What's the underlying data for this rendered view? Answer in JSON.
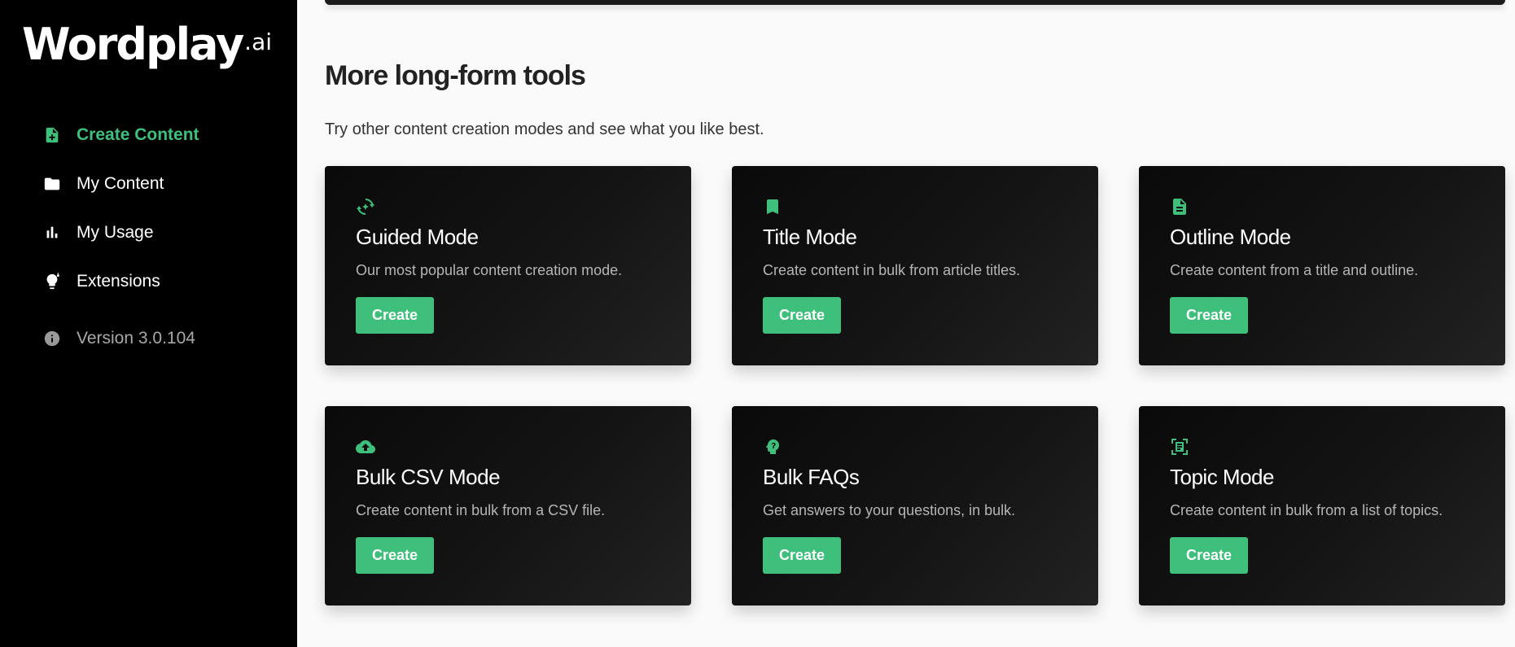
{
  "brand": {
    "name": "Wordplay",
    "suffix": ".ai"
  },
  "sidebar": {
    "items": [
      {
        "label": "Create Content",
        "icon": "file-plus-icon",
        "active": true
      },
      {
        "label": "My Content",
        "icon": "folder-icon",
        "active": false
      },
      {
        "label": "My Usage",
        "icon": "bar-chart-icon",
        "active": false
      },
      {
        "label": "Extensions",
        "icon": "lightbulb-icon",
        "active": false
      }
    ],
    "version": {
      "label": "Version 3.0.104",
      "icon": "info-icon"
    }
  },
  "main": {
    "title": "More long-form tools",
    "subtitle": "Try other content creation modes and see what you like best.",
    "cards": [
      {
        "title": "Guided Mode",
        "description": "Our most popular content creation mode.",
        "button": "Create",
        "icon": "guided-refresh-icon"
      },
      {
        "title": "Title Mode",
        "description": "Create content in bulk from article titles.",
        "button": "Create",
        "icon": "bookmark-icon"
      },
      {
        "title": "Outline Mode",
        "description": "Create content from a title and outline.",
        "button": "Create",
        "icon": "document-icon"
      },
      {
        "title": "Bulk CSV Mode",
        "description": "Create content in bulk from a CSV file.",
        "button": "Create",
        "icon": "cloud-upload-icon"
      },
      {
        "title": "Bulk FAQs",
        "description": "Get answers to your questions, in bulk.",
        "button": "Create",
        "icon": "head-question-icon"
      },
      {
        "title": "Topic Mode",
        "description": "Create content in bulk from a list of topics.",
        "button": "Create",
        "icon": "topic-frame-icon"
      }
    ]
  },
  "colors": {
    "accent": "#3ec07c",
    "sidebar_bg": "#000000",
    "page_bg": "#fafafa",
    "card_bg": "#111111"
  }
}
